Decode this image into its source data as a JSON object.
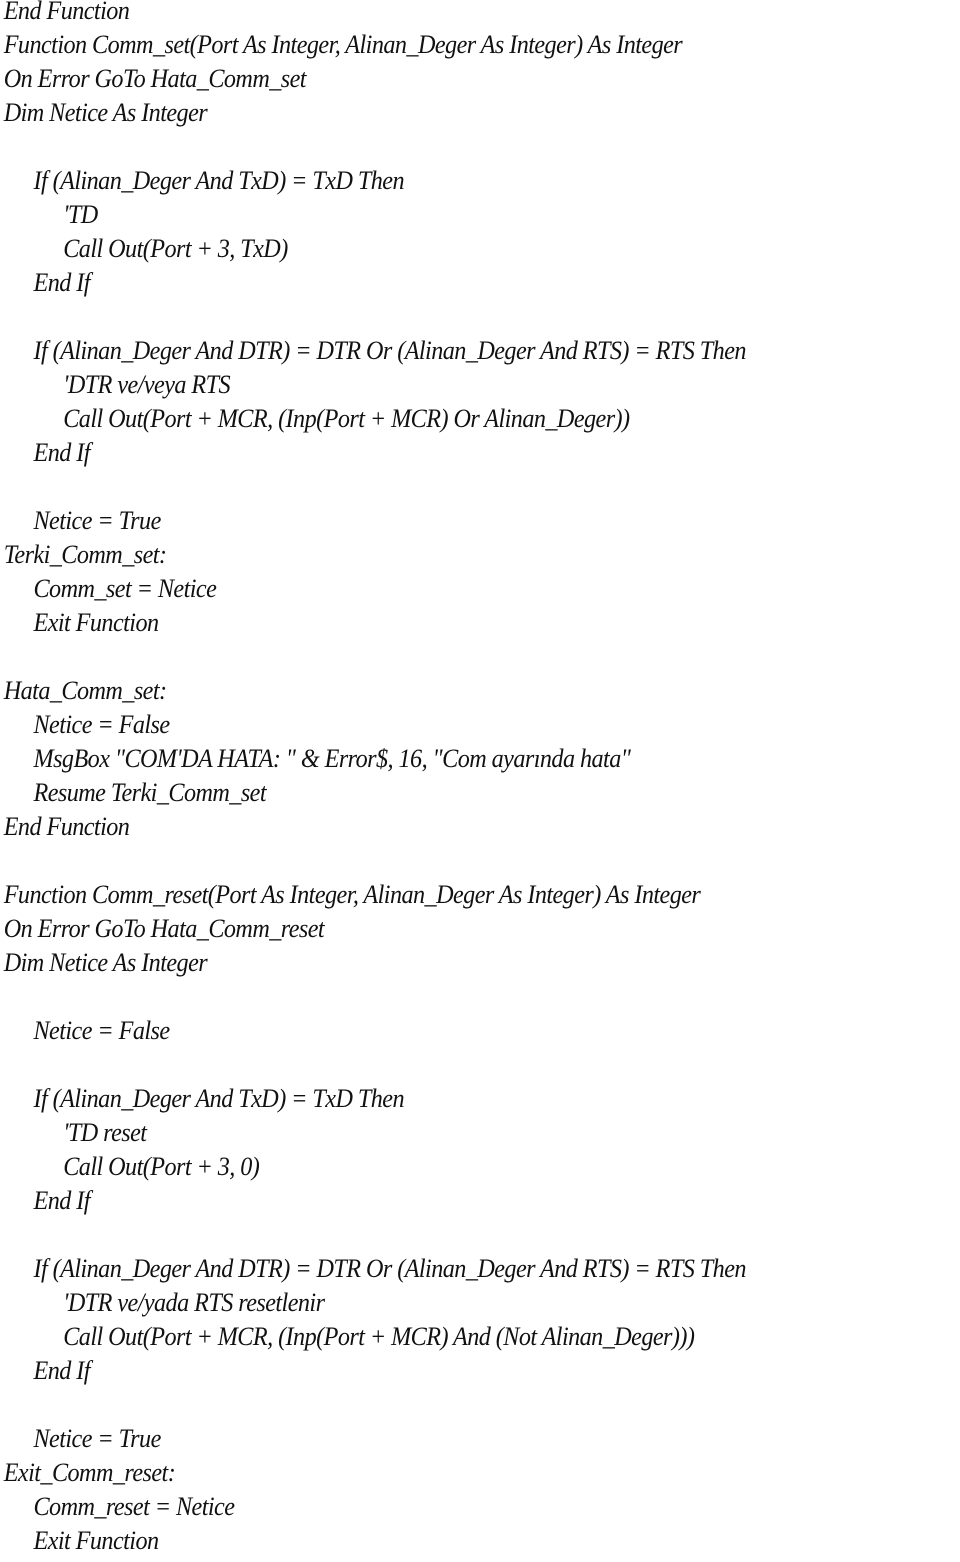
{
  "document": {
    "language": "Visual Basic",
    "lines": [
      {
        "indent": 0,
        "text": "End Function"
      },
      {
        "indent": 0,
        "text": "Function Comm_set(Port As Integer, Alinan_Deger As Integer) As Integer"
      },
      {
        "indent": 0,
        "text": "On Error GoTo Hata_Comm_set"
      },
      {
        "indent": 0,
        "text": "Dim Netice As Integer"
      },
      {
        "indent": 0,
        "text": ""
      },
      {
        "indent": 1,
        "text": "If (Alinan_Deger And TxD) = TxD Then"
      },
      {
        "indent": 2,
        "text": "'TD"
      },
      {
        "indent": 2,
        "text": "Call Out(Port + 3, TxD)"
      },
      {
        "indent": 1,
        "text": "End If"
      },
      {
        "indent": 0,
        "text": ""
      },
      {
        "indent": 1,
        "text": "If (Alinan_Deger And DTR) = DTR Or (Alinan_Deger And RTS) = RTS Then"
      },
      {
        "indent": 2,
        "text": "'DTR ve/veya RTS"
      },
      {
        "indent": 2,
        "text": "Call Out(Port + MCR, (Inp(Port + MCR) Or Alinan_Deger))"
      },
      {
        "indent": 1,
        "text": "End If"
      },
      {
        "indent": 0,
        "text": ""
      },
      {
        "indent": 1,
        "text": "Netice = True"
      },
      {
        "indent": 0,
        "text": "Terki_Comm_set:"
      },
      {
        "indent": 1,
        "text": "Comm_set = Netice"
      },
      {
        "indent": 1,
        "text": "Exit Function"
      },
      {
        "indent": 0,
        "text": ""
      },
      {
        "indent": 0,
        "text": "Hata_Comm_set:"
      },
      {
        "indent": 1,
        "text": "Netice = False"
      },
      {
        "indent": 1,
        "text": "MsgBox \"COM'DA HATA: \" & Error$, 16, \"Com ayarında hata\""
      },
      {
        "indent": 1,
        "text": "Resume Terki_Comm_set"
      },
      {
        "indent": 0,
        "text": "End Function"
      },
      {
        "indent": 0,
        "text": ""
      },
      {
        "indent": 0,
        "text": "Function Comm_reset(Port As Integer, Alinan_Deger As Integer) As Integer"
      },
      {
        "indent": 0,
        "text": "On Error GoTo Hata_Comm_reset"
      },
      {
        "indent": 0,
        "text": "Dim Netice As Integer"
      },
      {
        "indent": 0,
        "text": ""
      },
      {
        "indent": 1,
        "text": "Netice = False"
      },
      {
        "indent": 0,
        "text": ""
      },
      {
        "indent": 1,
        "text": "If (Alinan_Deger And TxD) = TxD Then"
      },
      {
        "indent": 2,
        "text": "'TD reset"
      },
      {
        "indent": 2,
        "text": "Call Out(Port + 3, 0)"
      },
      {
        "indent": 1,
        "text": "End If"
      },
      {
        "indent": 0,
        "text": ""
      },
      {
        "indent": 1,
        "text": "If (Alinan_Deger And DTR) = DTR Or (Alinan_Deger And RTS) = RTS Then"
      },
      {
        "indent": 2,
        "text": "'DTR ve/yada RTS resetlenir"
      },
      {
        "indent": 2,
        "text": "Call Out(Port + MCR, (Inp(Port + MCR) And (Not Alinan_Deger)))"
      },
      {
        "indent": 1,
        "text": "End If"
      },
      {
        "indent": 0,
        "text": ""
      },
      {
        "indent": 1,
        "text": "Netice = True"
      },
      {
        "indent": 0,
        "text": "Exit_Comm_reset:"
      },
      {
        "indent": 1,
        "text": "Comm_reset = Netice"
      },
      {
        "indent": 1,
        "text": "Exit Function"
      }
    ]
  }
}
